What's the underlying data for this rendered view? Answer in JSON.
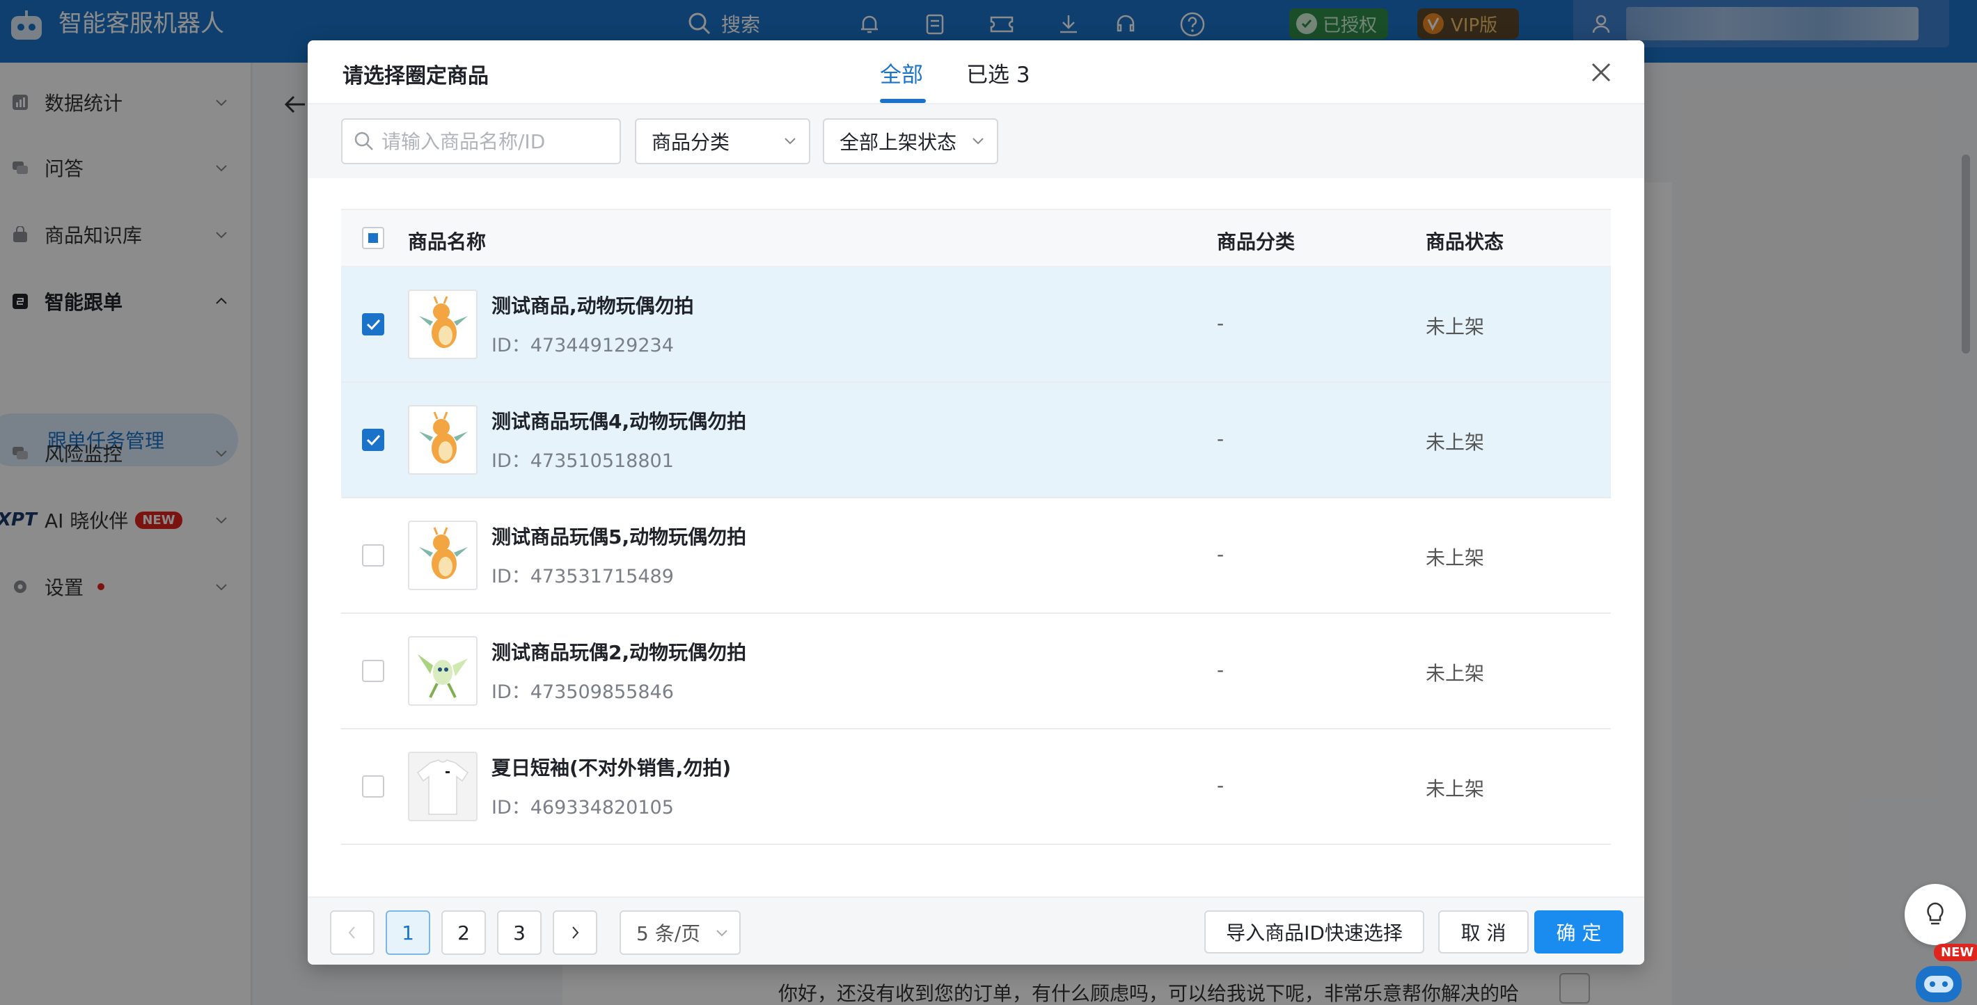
{
  "app": {
    "title": "智能客服机器人",
    "search_label": "搜索",
    "auth_badge": "已授权",
    "vip_badge": "VIP版"
  },
  "sidebar": {
    "items": [
      {
        "label": "数据统计",
        "icon": "bar-chart-icon"
      },
      {
        "label": "问答",
        "icon": "chat-icon"
      },
      {
        "label": "商品知识库",
        "icon": "bag-icon"
      },
      {
        "label": "智能跟单",
        "icon": "follow-icon",
        "expanded": true
      },
      {
        "label": "风险监控",
        "icon": "monitor-icon"
      },
      {
        "label": "AI 晓伙伴",
        "icon": "ai-icon",
        "badge": "NEW",
        "prefix": "XPT"
      },
      {
        "label": "设置",
        "icon": "gear-icon",
        "dot": true
      }
    ],
    "sub_item": "跟单任务管理"
  },
  "background": {
    "message_text": "你好，还没有收到您的订单，有什么顾虑吗，可以给我说下呢，非常乐意帮你解决的哈",
    "new_badge": "NEW"
  },
  "modal": {
    "title": "请选择圈定商品",
    "tabs": [
      {
        "label": "全部",
        "active": true
      },
      {
        "label": "已选 3",
        "active": false
      }
    ],
    "filters": {
      "search_placeholder": "请输入商品名称/ID",
      "category_select": "商品分类",
      "status_select": "全部上架状态"
    },
    "table": {
      "headers": {
        "name": "商品名称",
        "category": "商品分类",
        "status": "商品状态"
      },
      "rows": [
        {
          "name": "测试商品,动物玩偶勿拍",
          "id": "ID：473449129234",
          "category": "-",
          "status": "未上架",
          "checked": true,
          "thumb": "dragon"
        },
        {
          "name": "测试商品玩偶4,动物玩偶勿拍",
          "id": "ID：473510518801",
          "category": "-",
          "status": "未上架",
          "checked": true,
          "thumb": "dragon"
        },
        {
          "name": "测试商品玩偶5,动物玩偶勿拍",
          "id": "ID：473531715489",
          "category": "-",
          "status": "未上架",
          "checked": false,
          "thumb": "dragon"
        },
        {
          "name": "测试商品玩偶2,动物玩偶勿拍",
          "id": "ID：473509855846",
          "category": "-",
          "status": "未上架",
          "checked": false,
          "thumb": "fairy"
        },
        {
          "name": "夏日短袖(不对外销售,勿拍)",
          "id": "ID：469334820105",
          "category": "-",
          "status": "未上架",
          "checked": false,
          "thumb": "tshirt"
        }
      ]
    },
    "pagination": {
      "pages": [
        "1",
        "2",
        "3"
      ],
      "current": "1",
      "page_size": "5 条/页"
    },
    "buttons": {
      "import": "导入商品ID快速选择",
      "cancel": "取 消",
      "confirm": "确 定"
    }
  },
  "colors": {
    "primary": "#1a73c9",
    "topbar": "#1a73c9",
    "selected_row": "#e6f3fb",
    "confirm_button": "#1a8cf0"
  }
}
